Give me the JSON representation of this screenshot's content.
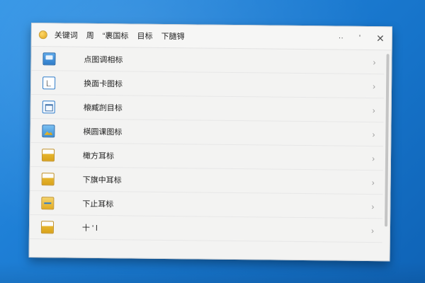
{
  "titlebar": {
    "menu": [
      "关键词",
      "周",
      "“裹国标",
      "目标",
      "下膸锝"
    ],
    "controls": {
      "minimize": "··",
      "maximize": "'",
      "close": "✕"
    }
  },
  "list": {
    "items": [
      {
        "label": "点图调相标",
        "icon": "blue-window-icon"
      },
      {
        "label": "换面卡图标",
        "icon": "document-icon"
      },
      {
        "label": "榱臧剀目标",
        "icon": "grid-icon"
      },
      {
        "label": "楧圆课图标",
        "icon": "image-icon"
      },
      {
        "label": "橄方耳标",
        "icon": "yellow-folder-icon"
      },
      {
        "label": "下旗中耳标",
        "icon": "yellow-folder-icon"
      },
      {
        "label": "下止耳标",
        "icon": "yellow-folder-bar-icon"
      },
      {
        "label": "十 ' l",
        "icon": "yellow-folder-icon"
      }
    ],
    "chevron": "›"
  }
}
